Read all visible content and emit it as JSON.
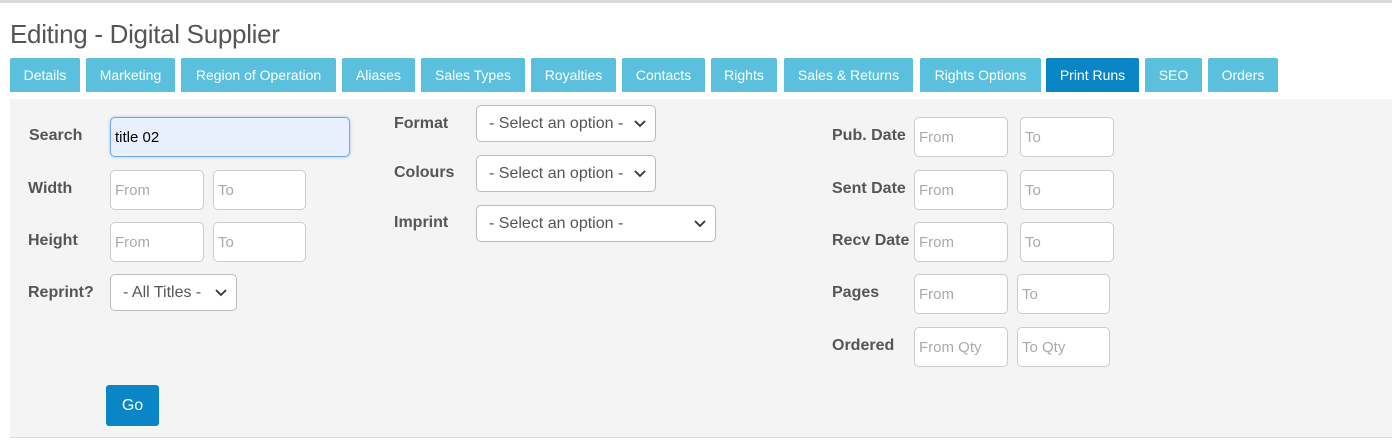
{
  "page_title": "Editing - Digital Supplier",
  "tabs": [
    {
      "label": "Details"
    },
    {
      "label": "Marketing"
    },
    {
      "label": "Region of Operation"
    },
    {
      "label": "Aliases"
    },
    {
      "label": "Sales Types"
    },
    {
      "label": "Royalties"
    },
    {
      "label": "Contacts"
    },
    {
      "label": "Rights"
    },
    {
      "label": "Sales & Returns"
    },
    {
      "label": "Rights Options"
    },
    {
      "label": "Print Runs",
      "active": true
    },
    {
      "label": "SEO"
    },
    {
      "label": "Orders"
    }
  ],
  "filters": {
    "search": {
      "label": "Search",
      "value": "title 02"
    },
    "width": {
      "label": "Width",
      "from_placeholder": "From",
      "to_placeholder": "To"
    },
    "height": {
      "label": "Height",
      "from_placeholder": "From",
      "to_placeholder": "To"
    },
    "reprint": {
      "label": "Reprint?",
      "selected": "- All Titles -"
    },
    "format": {
      "label": "Format",
      "selected": "- Select an option -"
    },
    "colours": {
      "label": "Colours",
      "selected": "- Select an option -"
    },
    "imprint": {
      "label": "Imprint",
      "selected": "- Select an option -"
    },
    "pub_date": {
      "label": "Pub. Date",
      "from_placeholder": "From",
      "to_placeholder": "To"
    },
    "sent_date": {
      "label": "Sent Date",
      "from_placeholder": "From",
      "to_placeholder": "To"
    },
    "recv_date": {
      "label": "Recv Date",
      "from_placeholder": "From",
      "to_placeholder": "To"
    },
    "pages": {
      "label": "Pages",
      "from_placeholder": "From",
      "to_placeholder": "To"
    },
    "ordered": {
      "label": "Ordered",
      "from_placeholder": "From Qty",
      "to_placeholder": "To Qty"
    }
  },
  "go_label": "Go",
  "colors": {
    "tab": "#5bc0de",
    "tab_active": "#0a86c7",
    "button": "#0a86c7"
  }
}
